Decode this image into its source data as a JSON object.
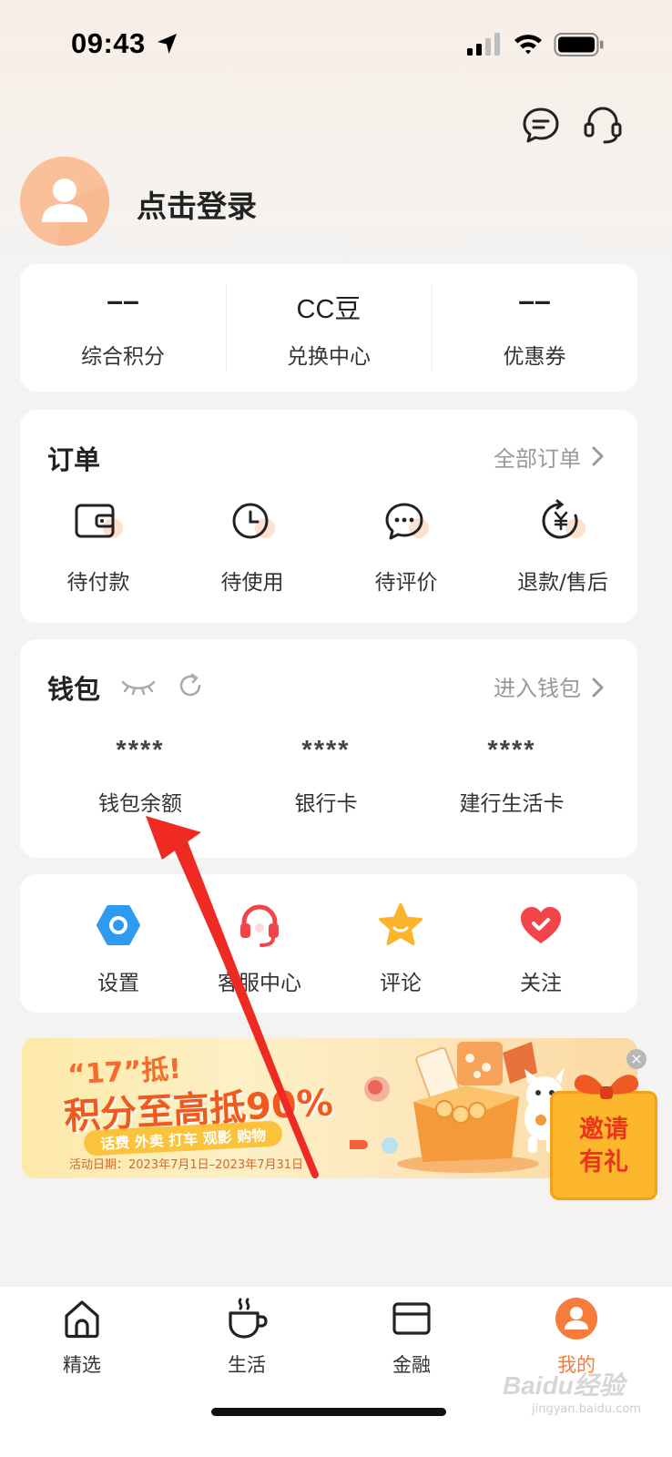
{
  "status_bar": {
    "time": "09:43"
  },
  "header": {
    "login_text": "点击登录"
  },
  "points": [
    {
      "value": "––",
      "label": "综合积分"
    },
    {
      "value": "CC豆",
      "label": "兑换中心"
    },
    {
      "value": "––",
      "label": "优惠券"
    }
  ],
  "orders": {
    "title": "订单",
    "all_link": "全部订单",
    "items": [
      {
        "label": "待付款",
        "icon": "wallet-icon"
      },
      {
        "label": "待使用",
        "icon": "clock-icon"
      },
      {
        "label": "待评价",
        "icon": "chat-icon"
      },
      {
        "label": "退款/售后",
        "icon": "refund-icon"
      }
    ]
  },
  "wallet": {
    "title": "钱包",
    "enter_link": "进入钱包",
    "items": [
      {
        "value": "****",
        "label": "钱包余额"
      },
      {
        "value": "****",
        "label": "银行卡"
      },
      {
        "value": "****",
        "label": "建行生活卡"
      }
    ]
  },
  "tools": [
    {
      "label": "设置",
      "icon": "settings-icon",
      "color": "#2f9bf0"
    },
    {
      "label": "客服中心",
      "icon": "headset-icon",
      "color": "#f2444a"
    },
    {
      "label": "评论",
      "icon": "star-icon",
      "color": "#fcb52a"
    },
    {
      "label": "关注",
      "icon": "heart-icon",
      "color": "#f2444a"
    }
  ],
  "banner": {
    "slogan": "“17”抵!",
    "headline": "积分至高抵90%",
    "tags": "话费 外卖 打车 观影 购物",
    "date": "活动日期：2023年7月1日–2023年7月31日",
    "close": "×"
  },
  "invite": {
    "line1": "邀请",
    "line2": "有礼"
  },
  "bottom_nav": [
    {
      "label": "精选",
      "icon": "home-icon"
    },
    {
      "label": "生活",
      "icon": "cup-icon"
    },
    {
      "label": "金融",
      "icon": "card-icon"
    },
    {
      "label": "我的",
      "icon": "profile-icon",
      "active": true
    }
  ],
  "watermark": {
    "text": "Baidu经验",
    "sub": "jingyan.baidu.com"
  },
  "colors": {
    "accent": "#f57c3c",
    "arrow": "#ee2a22"
  }
}
